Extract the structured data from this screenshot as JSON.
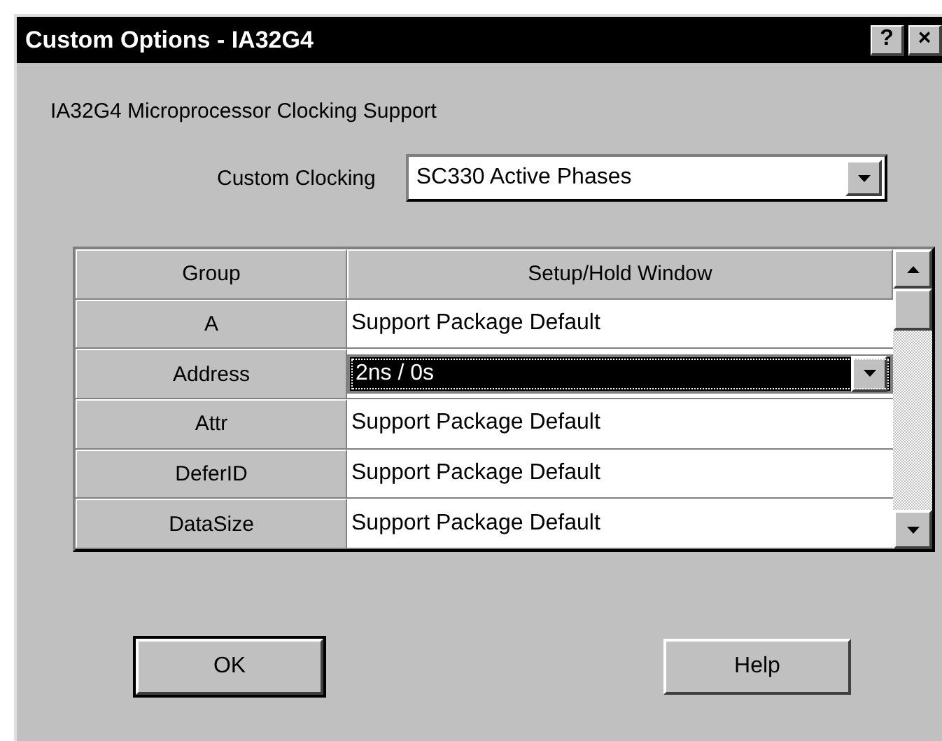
{
  "window": {
    "title": "Custom Options - IA32G4",
    "title_buttons": [
      "?",
      "×"
    ]
  },
  "heading": "IA32G4 Microprocessor Clocking Support",
  "custom_clocking": {
    "label": "Custom Clocking",
    "value": "SC330 Active Phases"
  },
  "table": {
    "columns": [
      "Group",
      "Setup/Hold Window"
    ],
    "rows": [
      {
        "group": "A",
        "value": "Support Package Default",
        "kind": "text"
      },
      {
        "group": "Address",
        "value": "2ns / 0s",
        "kind": "combo"
      },
      {
        "group": "Attr",
        "value": "Support Package Default",
        "kind": "text"
      },
      {
        "group": "DeferID",
        "value": "Support Package Default",
        "kind": "text"
      },
      {
        "group": "DataSize",
        "value": "Support Package Default",
        "kind": "text"
      }
    ]
  },
  "buttons": [
    {
      "label": "OK",
      "default": true
    },
    {
      "label": "Help",
      "default": false
    }
  ]
}
